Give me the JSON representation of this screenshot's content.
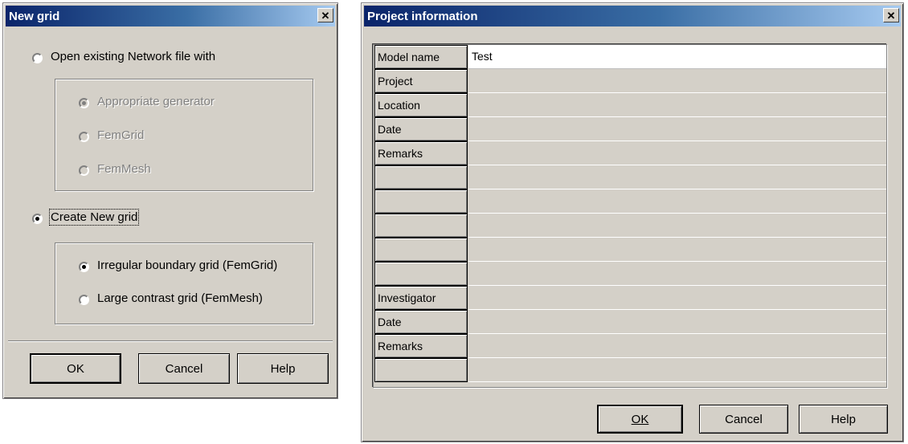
{
  "new_grid": {
    "title": "New grid",
    "close_glyph": "✕",
    "open_existing_label": "Open existing Network file with",
    "generator_options": [
      "Appropriate generator",
      "FemGrid",
      "FemMesh"
    ],
    "create_new_label": "Create New grid",
    "grid_options": [
      "Irregular boundary grid (FemGrid)",
      "Large contrast grid (FemMesh)"
    ],
    "buttons": {
      "ok": "OK",
      "cancel": "Cancel",
      "help": "Help"
    }
  },
  "project_info": {
    "title": "Project information",
    "close_glyph": "✕",
    "rows": [
      {
        "label": "Model name",
        "value": "Test"
      },
      {
        "label": "Project",
        "value": ""
      },
      {
        "label": "Location",
        "value": ""
      },
      {
        "label": "Date",
        "value": ""
      },
      {
        "label": "Remarks",
        "value": ""
      },
      {
        "label": "",
        "value": ""
      },
      {
        "label": "",
        "value": ""
      },
      {
        "label": "",
        "value": ""
      },
      {
        "label": "",
        "value": ""
      },
      {
        "label": "",
        "value": ""
      },
      {
        "label": "Investigator",
        "value": ""
      },
      {
        "label": "Date",
        "value": ""
      },
      {
        "label": "Remarks",
        "value": ""
      },
      {
        "label": "",
        "value": ""
      }
    ],
    "buttons": {
      "ok": "OK",
      "cancel": "Cancel",
      "help": "Help"
    }
  },
  "colors": {
    "titlebar_start": "#0a246a",
    "titlebar_end": "#a6caf0",
    "face": "#d4d0c8"
  }
}
